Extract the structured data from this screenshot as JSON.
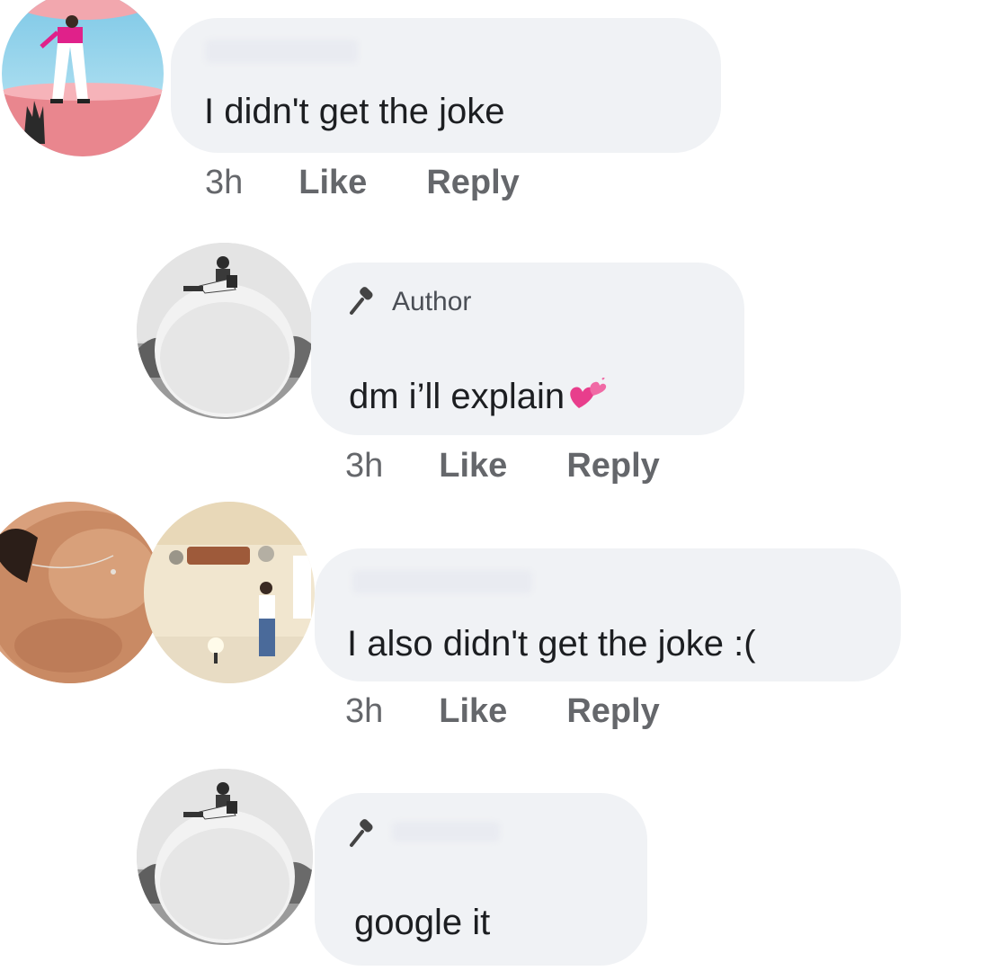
{
  "comments": [
    {
      "text": "I didn't get the joke",
      "time": "3h",
      "like_label": "Like",
      "reply_label": "Reply"
    },
    {
      "badge": "Author",
      "text": "dm i’ll explain",
      "emoji": "heart-icon",
      "time": "3h",
      "like_label": "Like",
      "reply_label": "Reply"
    },
    {
      "text": "I also didn't get the joke :(",
      "time": "3h",
      "like_label": "Like",
      "reply_label": "Reply"
    },
    {
      "badge_icon": "microphone-icon",
      "text": "google it"
    }
  ],
  "colors": {
    "bubble": "#f0f2f5",
    "text": "#1c1e21",
    "meta": "#65676b",
    "heart": "#e83e8c"
  }
}
